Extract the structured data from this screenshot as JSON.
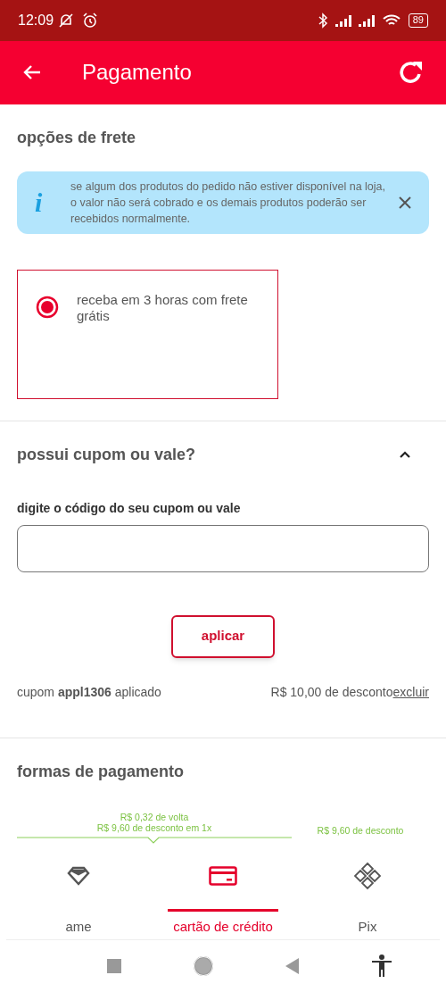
{
  "status_bar": {
    "time": "12:09",
    "battery": "89"
  },
  "app_bar": {
    "title": "Pagamento"
  },
  "shipping": {
    "title": "opções de frete",
    "notice": {
      "icon": "i",
      "text": "se algum dos produtos do pedido não estiver disponível na loja, o valor não será cobrado e os demais produtos poderão ser recebidos normalmente."
    },
    "options": [
      {
        "label": "receba em 3 horas com frete grátis",
        "selected": true
      }
    ]
  },
  "coupon": {
    "title": "possui cupom ou vale?",
    "expanded": true,
    "field_label": "digite o código do seu cupom ou vale",
    "apply_button": "aplicar",
    "applied": {
      "text": "cupom **appl1306** aplicado",
      "discount": "R$ 10,00 de desconto",
      "remove_link": "excluir"
    }
  },
  "payment": {
    "title": "formas de pagamento",
    "promos": [
      {
        "kind": "bracket",
        "lines": [
          "R$ 0,32 de volta",
          "R$ 9,60 de desconto em 1x"
        ]
      },
      {
        "kind": "plain",
        "lines": [
          "R$ 9,60 de desconto"
        ]
      }
    ],
    "tabs": [
      {
        "kind": "ame",
        "label": "ame",
        "selected": false
      },
      {
        "kind": "card",
        "label": "cartão de crédito",
        "selected": true
      },
      {
        "kind": "pix",
        "label": "Pix",
        "selected": false
      }
    ]
  }
}
